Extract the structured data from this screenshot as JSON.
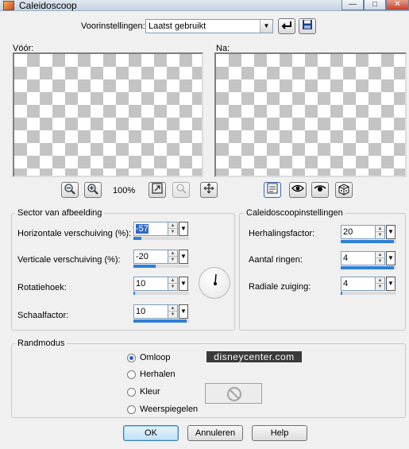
{
  "window": {
    "title": "Caleidoscoop",
    "controls": {
      "minimize": "—",
      "maximize": "□",
      "close": "✕"
    }
  },
  "presets": {
    "label": "Voorinstellingen:",
    "value": "Laatst gebruikt"
  },
  "preview": {
    "before_label": "Vóór:",
    "after_label": "Na:",
    "zoom": "100%",
    "icons": [
      "zoom-out-icon",
      "zoom-in-icon",
      "fit-icon",
      "proof-icon",
      "pan-icon",
      "preview-toggle-icon",
      "reset-icon",
      "eye-icon",
      "randomize-icon"
    ]
  },
  "sector": {
    "title": "Sector van afbeelding",
    "fields": [
      {
        "label": "Horizontale verschuiving (%):",
        "value": "-57",
        "level": 0.14
      },
      {
        "label": "Verticale verschuiving (%):",
        "value": "-20",
        "level": 0.4
      },
      {
        "label": "Rotatiehoek:",
        "value": "10",
        "level": 0.03
      },
      {
        "label": "Schaalfactor:",
        "value": "10",
        "level": 0.95
      }
    ]
  },
  "kaleido": {
    "title": "Caleidoscoopinstellingen",
    "fields": [
      {
        "label": "Herhalingsfactor:",
        "value": "20",
        "level": 0.95
      },
      {
        "label": "Aantal ringen:",
        "value": "4",
        "level": 0.95
      },
      {
        "label": "Radiale zuiging:",
        "value": "4",
        "level": 0.03
      }
    ]
  },
  "edge": {
    "title": "Randmodus",
    "options": [
      "Omloop",
      "Herhalen",
      "Kleur",
      "Weerspiegelen"
    ],
    "selected": "Omloop"
  },
  "watermark": "disneycenter.com",
  "buttons": {
    "ok": "OK",
    "cancel": "Annuleren",
    "help": "Help"
  },
  "colors": {
    "accent": "#2f7fd8",
    "selection": "#316ac5"
  }
}
